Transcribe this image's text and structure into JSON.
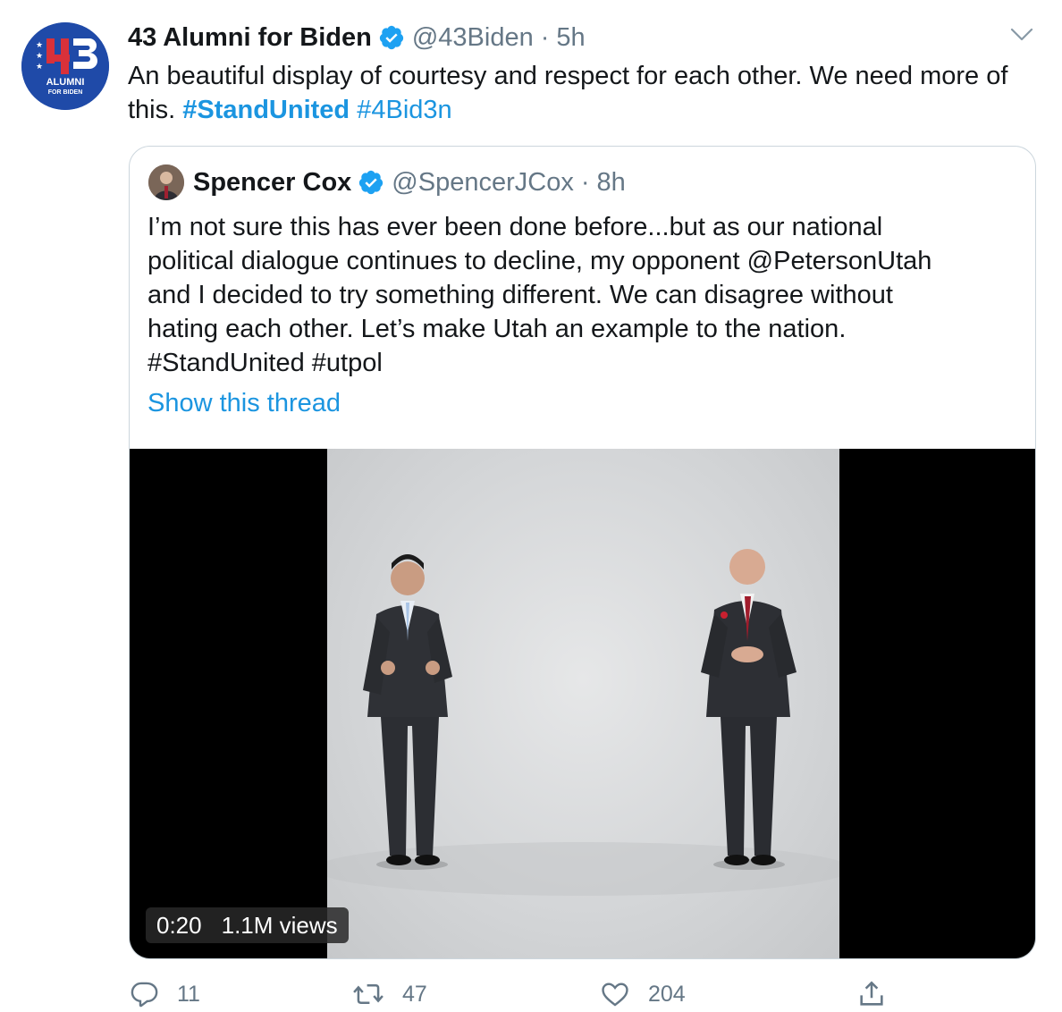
{
  "tweet": {
    "display_name": "43 Alumni for Biden",
    "handle": "@43Biden",
    "separator": "·",
    "time": "5h",
    "avatar_text_line1": "ALUMNI",
    "avatar_text_line2": "FOR BIDEN",
    "avatar_number": "43",
    "text": "An beautiful display of courtesy and respect for each other. We need more of this.",
    "hashtag_1": "#StandUnited",
    "hashtag_2": "#4Bid3n"
  },
  "quote": {
    "display_name": "Spencer Cox",
    "handle": "@SpencerJCox",
    "separator": "·",
    "time": "8h",
    "text_line1": "I’m not sure this has ever been done before...but as our national",
    "text_line2": "political dialogue continues to decline, my opponent @PetersonUtah",
    "text_line3": "and I decided to try something different. We can disagree without",
    "text_line4": "hating each other. Let’s make Utah an example to the nation.",
    "text_line5": "#StandUnited #utpol",
    "show_thread": "Show this thread",
    "video": {
      "duration": "0:20",
      "views": "1.1M views"
    }
  },
  "actions": {
    "reply_count": "11",
    "retweet_count": "47",
    "like_count": "204"
  },
  "colors": {
    "link": "#1b95e0",
    "muted": "#657786",
    "verified": "#1da1f2",
    "avatar_bg": "#1f4aa8"
  },
  "icons": [
    "verified-badge-icon",
    "chevron-down-icon",
    "reply-icon",
    "retweet-icon",
    "like-icon",
    "share-icon"
  ]
}
